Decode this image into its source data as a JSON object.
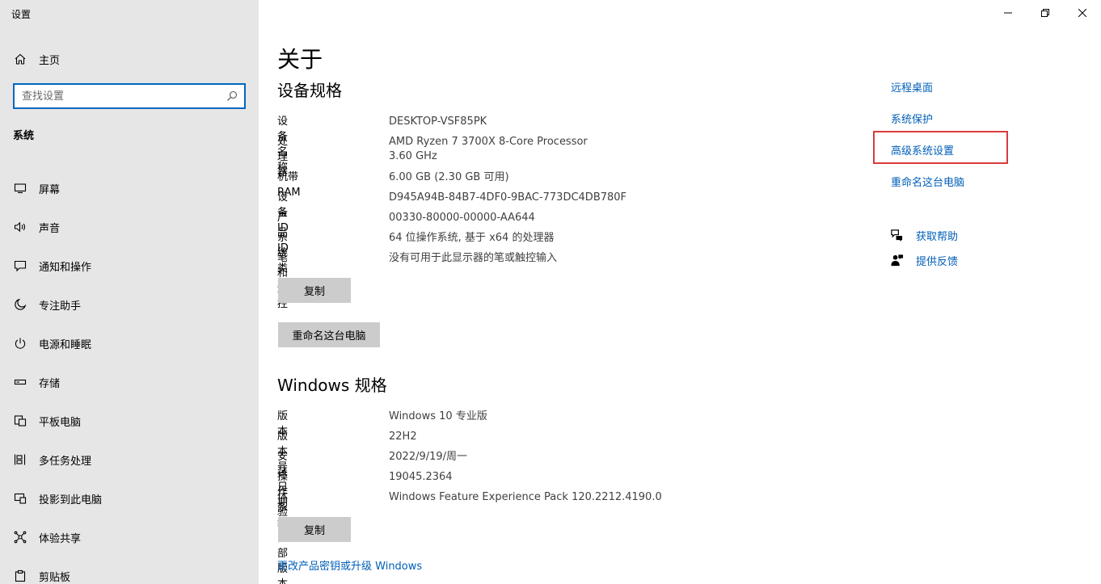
{
  "window": {
    "title": "设置"
  },
  "sidebar": {
    "home_label": "主页",
    "search_placeholder": "查找设置",
    "section_label": "系统",
    "items": [
      {
        "label": "屏幕",
        "icon": "monitor-icon"
      },
      {
        "label": "声音",
        "icon": "speaker-icon"
      },
      {
        "label": "通知和操作",
        "icon": "notification-icon"
      },
      {
        "label": "专注助手",
        "icon": "moon-icon"
      },
      {
        "label": "电源和睡眠",
        "icon": "power-icon"
      },
      {
        "label": "存储",
        "icon": "storage-icon"
      },
      {
        "label": "平板电脑",
        "icon": "tablet-icon"
      },
      {
        "label": "多任务处理",
        "icon": "multitask-icon"
      },
      {
        "label": "投影到此电脑",
        "icon": "project-icon"
      },
      {
        "label": "体验共享",
        "icon": "share-icon"
      },
      {
        "label": "剪贴板",
        "icon": "clipboard-icon"
      }
    ]
  },
  "main": {
    "title": "关于",
    "device_specs": {
      "heading": "设备规格",
      "rows": [
        {
          "key": "设备名称",
          "value": "DESKTOP-VSF85PK"
        },
        {
          "key": "处理器",
          "value": "AMD Ryzen 7 3700X 8-Core Processor",
          "value2": "3.60 GHz"
        },
        {
          "key": "机带 RAM",
          "value": "6.00 GB (2.30 GB 可用)"
        },
        {
          "key": "设备 ID",
          "value": "D945A94B-84B7-4DF0-9BAC-773DC4DB780F"
        },
        {
          "key": "产品 ID",
          "value": "00330-80000-00000-AA644"
        },
        {
          "key": "系统类型",
          "value": "64 位操作系统, 基于 x64 的处理器"
        },
        {
          "key": "笔和触控",
          "value": "没有可用于此显示器的笔或触控输入"
        }
      ],
      "copy_label": "复制",
      "rename_label": "重命名这台电脑"
    },
    "windows_specs": {
      "heading": "Windows 规格",
      "rows": [
        {
          "key": "版本",
          "value": "Windows 10 专业版"
        },
        {
          "key": "版本号",
          "value": "22H2"
        },
        {
          "key": "安装日期",
          "value": "2022/9/19/周一"
        },
        {
          "key": "操作系统内部版本",
          "value": "19045.2364"
        },
        {
          "key": "体验",
          "value": "Windows Feature Experience Pack 120.2212.4190.0"
        }
      ],
      "copy_label": "复制"
    },
    "upgrade_link": "更改产品密钥或升级 Windows"
  },
  "related": {
    "links": [
      "远程桌面",
      "系统保护",
      "高级系统设置",
      "重命名这台电脑"
    ],
    "help_label": "获取帮助",
    "feedback_label": "提供反馈"
  },
  "colors": {
    "accent": "#005fb8",
    "highlight": "#d83b3b",
    "sidebar_bg": "#e6e6e6"
  }
}
